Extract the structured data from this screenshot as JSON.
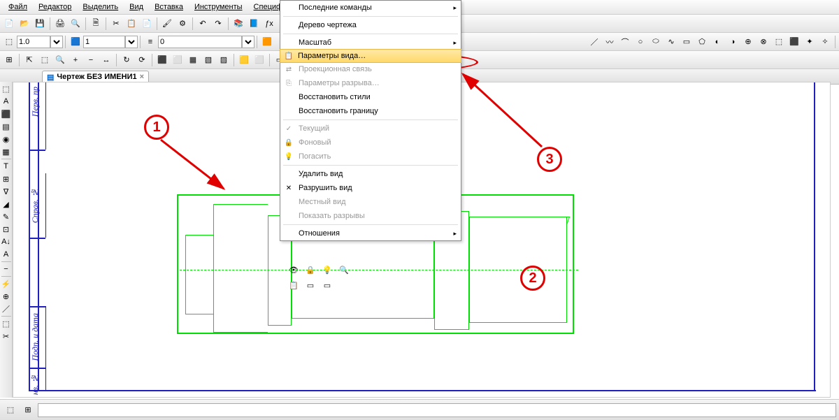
{
  "menubar": [
    "Файл",
    "Редактор",
    "Выделить",
    "Вид",
    "Вставка",
    "Инструменты",
    "Спецификация"
  ],
  "ctx": {
    "recent": "Последние команды",
    "tree": "Дерево чертежа",
    "scale": "Масштаб",
    "view_params": "Параметры вида…",
    "proj_link": "Проекционная связь",
    "break_params": "Параметры разрыва…",
    "restore_styles": "Восстановить стили",
    "restore_border": "Восстановить границу",
    "current": "Текущий",
    "background": "Фоновый",
    "off": "Погасить",
    "delete_view": "Удалить вид",
    "destroy_view": "Разрушить вид",
    "local_view": "Местный вид",
    "show_breaks": "Показать разрывы",
    "relations": "Отношения"
  },
  "tab": {
    "title": "Чертеж БЕЗ ИМЕНИ1"
  },
  "toolbar2": {
    "val1": "1.0",
    "val2": "1",
    "val3": "0"
  },
  "vlabels": {
    "a": "Перв. пр",
    "b": "Справ. №",
    "c": "Подп. и дата",
    "d": "нв. №"
  },
  "markers": {
    "m1": "1",
    "m2": "2",
    "m3": "3"
  }
}
